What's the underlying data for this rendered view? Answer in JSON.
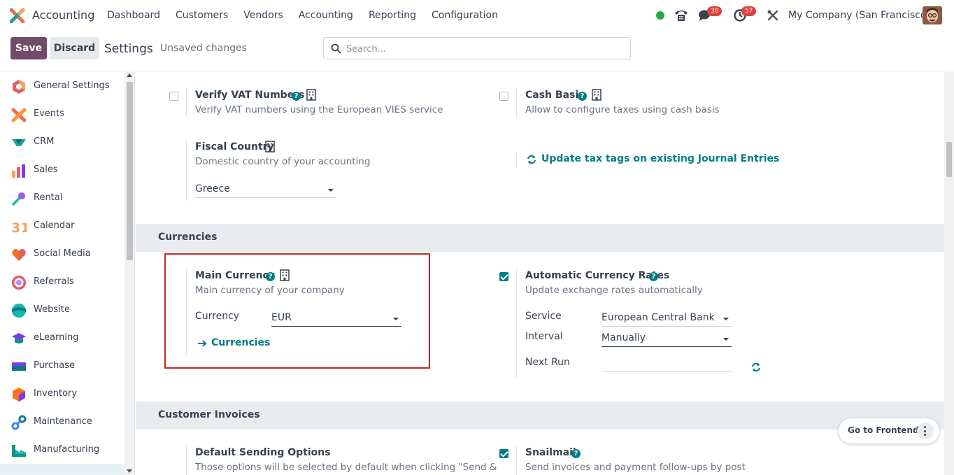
{
  "app": {
    "name": "Accounting",
    "menu": [
      "Dashboard",
      "Customers",
      "Vendors",
      "Accounting",
      "Reporting",
      "Configuration"
    ],
    "company": "My Company (San Francisco)",
    "chat_badge": "30",
    "activity_badge": "57"
  },
  "control": {
    "save_label": "Save",
    "discard_label": "Discard",
    "breadcrumb": "Settings",
    "status": "Unsaved changes",
    "search_placeholder": "Search..."
  },
  "sidebar": {
    "items": [
      {
        "label": "General Settings",
        "icon": "general-settings-icon"
      },
      {
        "label": "Events",
        "icon": "events-icon"
      },
      {
        "label": "CRM",
        "icon": "crm-icon"
      },
      {
        "label": "Sales",
        "icon": "sales-icon"
      },
      {
        "label": "Rental",
        "icon": "rental-icon"
      },
      {
        "label": "Calendar",
        "icon": "calendar-icon",
        "icon_text": "31"
      },
      {
        "label": "Social Media",
        "icon": "social-media-icon"
      },
      {
        "label": "Referrals",
        "icon": "referrals-icon"
      },
      {
        "label": "Website",
        "icon": "website-icon"
      },
      {
        "label": "eLearning",
        "icon": "elearning-icon"
      },
      {
        "label": "Purchase",
        "icon": "purchase-icon"
      },
      {
        "label": "Inventory",
        "icon": "inventory-icon"
      },
      {
        "label": "Maintenance",
        "icon": "maintenance-icon"
      },
      {
        "label": "Manufacturing",
        "icon": "manufacturing-icon"
      }
    ]
  },
  "taxes": {
    "verify_vat": {
      "title": "Verify VAT Numbers",
      "desc": "Verify VAT numbers using the European VIES service",
      "checked": false
    },
    "cash_basis": {
      "title": "Cash Basis",
      "desc": "Allow to configure taxes using cash basis",
      "checked": false
    },
    "fiscal_country": {
      "title": "Fiscal Country",
      "desc": "Domestic country of your accounting",
      "value": "Greece"
    },
    "update_tags_link": "Update tax tags on existing Journal Entries"
  },
  "currencies": {
    "section_title": "Currencies",
    "main_currency": {
      "title": "Main Currency",
      "desc": "Main currency of your company",
      "field_label": "Currency",
      "value": "EUR",
      "link": "Currencies"
    },
    "auto_rates": {
      "title": "Automatic Currency Rates",
      "desc": "Update exchange rates automatically",
      "checked": true,
      "service_label": "Service",
      "service_value": "European Central Bank",
      "interval_label": "Interval",
      "interval_value": "Manually",
      "next_run_label": "Next Run",
      "next_run_value": ""
    }
  },
  "invoices": {
    "section_title": "Customer Invoices",
    "sending": {
      "title": "Default Sending Options",
      "desc": "Those options will be selected by default when clicking \"Send &"
    },
    "snailmail": {
      "title": "Snailmail",
      "desc": "Send invoices and payment follow-ups by post",
      "checked": true
    }
  },
  "frontend": {
    "label": "Go to Frontend"
  },
  "colors": {
    "brand": "#714b67",
    "accent": "#017e84",
    "badge": "#e0413e",
    "highlight_box": "#c62828"
  }
}
